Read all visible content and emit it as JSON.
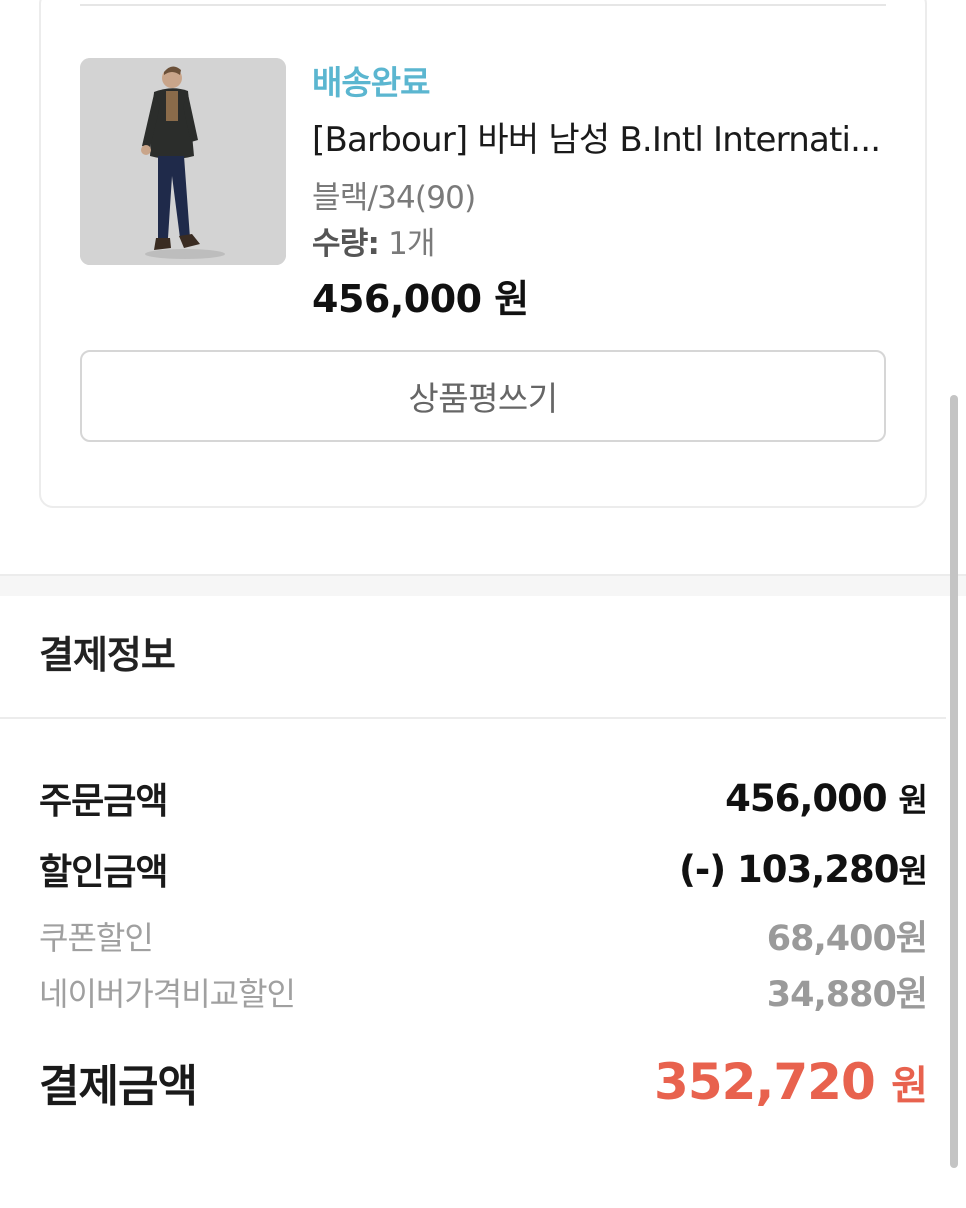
{
  "order_item": {
    "status": "배송완료",
    "product_name": "[Barbour] 바버 남성 B.Intl Internati...",
    "option": "블랙/34(90)",
    "quantity_label": "수량:",
    "quantity_value": "1개",
    "price": "456,000 원",
    "review_button": "상품평쓰기",
    "thumbnail_icon": "product-photo-man-in-jacket"
  },
  "payment": {
    "title": "결제정보",
    "order_amount_label": "주문금액",
    "order_amount_value": "456,000",
    "order_amount_unit": "원",
    "discount_label": "할인금액",
    "discount_value": "(-) 103,280",
    "discount_unit": "원",
    "coupon_label": "쿠폰할인",
    "coupon_value": "68,400원",
    "naver_label": "네이버가격비교할인",
    "naver_value": "34,880원",
    "total_label": "결제금액",
    "total_value": "352,720",
    "total_unit": "원"
  },
  "colors": {
    "status": "#5bb6d0",
    "total": "#e8624e"
  }
}
